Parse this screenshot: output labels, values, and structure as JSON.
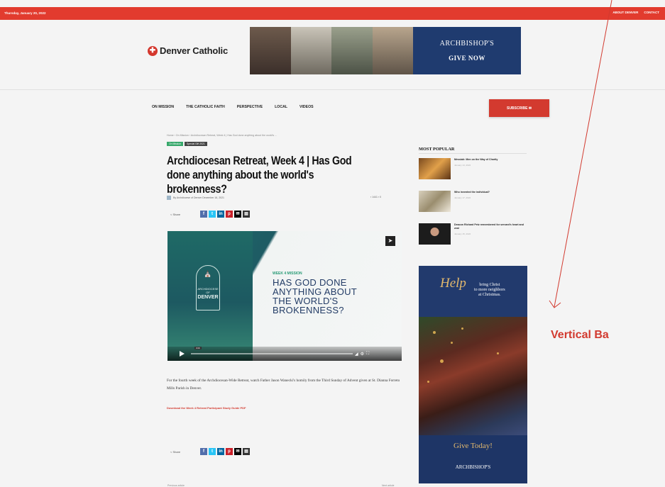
{
  "topbar": {
    "date": "Thursday, January 20, 2022",
    "links": [
      "ABOUT DENVER",
      "CONTACT"
    ]
  },
  "header": {
    "logo_text": "Denver Catholic",
    "banner_brand": "ARCHBISHOP'S",
    "banner_cta": "GIVE NOW"
  },
  "nav": {
    "items": [
      "ON MISSION",
      "THE CATHOLIC FAITH",
      "PERSPECTIVE",
      "LOCAL",
      "VIDEOS"
    ],
    "subscribe_label": "SUBSCRIBE ✉"
  },
  "article": {
    "breadcrumb": "Home › On Mission › Archdiocesan Retreat, Week 4 | Has God done anything about the world's ...",
    "tags": [
      "On Mission",
      "Special Gift 2021"
    ],
    "title": "Archdiocesan Retreat, Week 4 | Has God done anything about the world's brokenness?",
    "byline": "By Archdiocese of Denver   December 16, 2021",
    "meta_right": "▪ 1441   ▪ 0",
    "share_label": "< Share",
    "video": {
      "seal_text": "ARCHDIOCESE OF",
      "seal_name": "DENVER",
      "kicker": "WEEK 4 MISSION",
      "headline_lines": [
        "HAS GOD DONE",
        "ANYTHING ABOUT",
        "THE WORLD'S",
        "BROKENNESS?"
      ],
      "time": "0:00"
    },
    "body": "For the fourth week of the Archdiocesan-Wide Retreat, watch Father Jason Wanecki's homily from the Third Sunday of Advent given at St. Dianna Forreto Mills Parish in Denver.",
    "pdf_link": "Download the Week 4 Retreat Participant Study Guide PDF",
    "prev": "Previous article",
    "next": "Next article"
  },
  "sidebar": {
    "most_popular_title": "MOST POPULAR",
    "items": [
      {
        "title": "Messiah: Men on the Way of Charity",
        "date": "January 14, 2022"
      },
      {
        "title": "Who invented the individual?",
        "date": "January 17, 2022"
      },
      {
        "title": "Deacon Richard Petz remembered for servant's heart and zeal",
        "date": "January 15, 2022"
      }
    ],
    "ad": {
      "script": "Help",
      "lines": [
        "bring Christ",
        "to more neighbors",
        "at Christmas."
      ],
      "give": "Give Today!",
      "org": "ARCHBISHOP'S"
    }
  },
  "annotation": {
    "label": "Vertical Ba",
    "color": "#d23a2f"
  }
}
